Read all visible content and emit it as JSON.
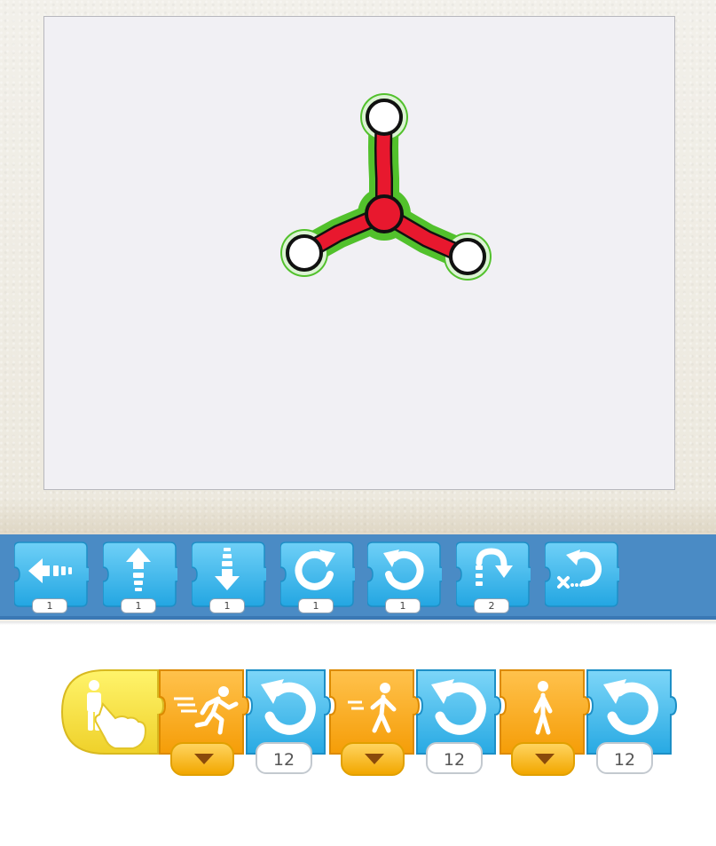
{
  "palette": {
    "blocks": [
      {
        "name": "move-left-block",
        "icon": "move-left-icon",
        "count": "1"
      },
      {
        "name": "move-up-block",
        "icon": "move-up-icon",
        "count": "1"
      },
      {
        "name": "move-down-block",
        "icon": "move-down-icon",
        "count": "1"
      },
      {
        "name": "turn-right-block",
        "icon": "turn-right-icon",
        "count": "1"
      },
      {
        "name": "turn-left-block",
        "icon": "turn-left-icon",
        "count": "1"
      },
      {
        "name": "hop-block",
        "icon": "hop-icon",
        "count": "2"
      },
      {
        "name": "reset-block",
        "icon": "reset-icon",
        "count": ""
      }
    ]
  },
  "script": {
    "trigger": {
      "icon": "tap-icon"
    },
    "values": [
      "12",
      "12",
      "12"
    ],
    "speed_icons": [
      "run-fast-icon",
      "walk-medium-icon",
      "walk-slow-icon"
    ]
  },
  "colors": {
    "palette_bg": "#4a8bc5",
    "motion_blue": "#35b2ea",
    "speed_orange": "#f7a711",
    "trigger_yellow": "#f6e23a",
    "spinner_red": "#e8182e",
    "spinner_outline": "#51c02e"
  }
}
